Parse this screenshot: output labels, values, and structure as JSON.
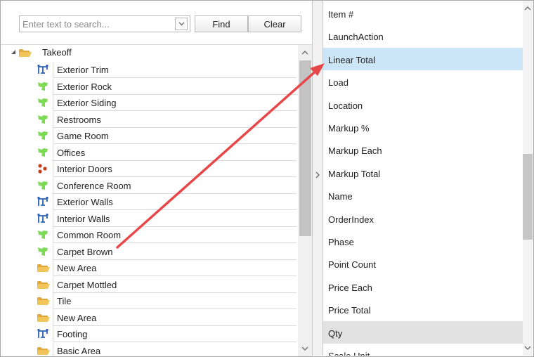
{
  "search": {
    "placeholder": "Enter text to search...",
    "find_label": "Find",
    "clear_label": "Clear"
  },
  "tree": {
    "root": {
      "label": "Takeoff",
      "icon": "folder-icon"
    },
    "items": [
      {
        "label": "Exterior Trim",
        "icon": "linear-icon"
      },
      {
        "label": "Exterior Rock",
        "icon": "area-icon"
      },
      {
        "label": "Exterior Siding",
        "icon": "area-icon"
      },
      {
        "label": "Restrooms",
        "icon": "area-icon"
      },
      {
        "label": "Game Room",
        "icon": "area-icon"
      },
      {
        "label": "Offices",
        "icon": "area-icon"
      },
      {
        "label": "Interior Doors",
        "icon": "count-icon"
      },
      {
        "label": "Conference Room",
        "icon": "area-icon"
      },
      {
        "label": "Exterior Walls",
        "icon": "linear-icon"
      },
      {
        "label": "Interior Walls",
        "icon": "linear-icon"
      },
      {
        "label": "Common Room",
        "icon": "area-icon"
      },
      {
        "label": "Carpet Brown",
        "icon": "area-icon"
      },
      {
        "label": "New Area",
        "icon": "folder-icon"
      },
      {
        "label": "Carpet Mottled",
        "icon": "folder-icon"
      },
      {
        "label": "Tile",
        "icon": "folder-icon"
      },
      {
        "label": "New Area",
        "icon": "folder-icon"
      },
      {
        "label": "Footing",
        "icon": "linear-icon"
      },
      {
        "label": "Basic Area",
        "icon": "folder-icon"
      }
    ]
  },
  "properties": {
    "items": [
      {
        "label": "Item #"
      },
      {
        "label": "LaunchAction"
      },
      {
        "label": "Linear Total",
        "state": "selected"
      },
      {
        "label": "Load"
      },
      {
        "label": "Location"
      },
      {
        "label": "Markup %"
      },
      {
        "label": "Markup Each"
      },
      {
        "label": "Markup Total"
      },
      {
        "label": "Name"
      },
      {
        "label": "OrderIndex"
      },
      {
        "label": "Phase"
      },
      {
        "label": "Point Count"
      },
      {
        "label": "Price Each"
      },
      {
        "label": "Price Total"
      },
      {
        "label": "Qty",
        "state": "hover"
      },
      {
        "label": "Scale Unit"
      }
    ]
  },
  "colors": {
    "selected_bg": "#cde6f7",
    "hover_bg": "#e2e2e2",
    "annotation_arrow": "#e8474a",
    "area_icon": "#7ed957",
    "linear_icon": "#2d63b8",
    "count_icon": "#c8401a",
    "folder_icon": "#f2c55c"
  }
}
